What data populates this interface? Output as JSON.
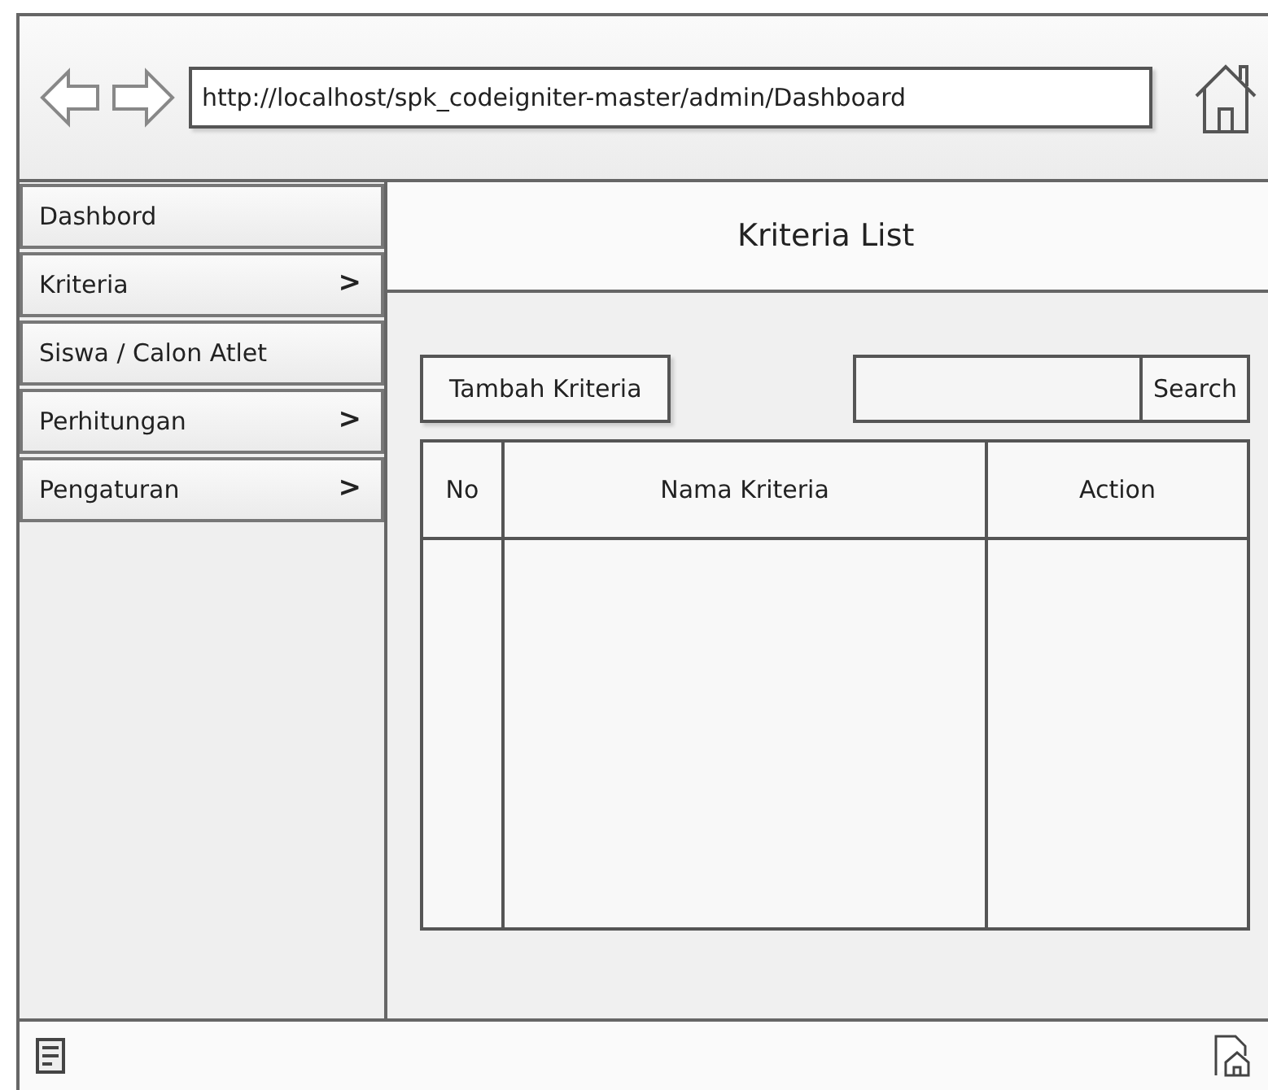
{
  "address_bar": {
    "url": "http://localhost/spk_codeigniter-master/admin/Dashboard"
  },
  "sidebar": {
    "items": [
      {
        "label": "Dashbord"
      },
      {
        "label": "Kriteria",
        "arrow": ">"
      },
      {
        "label": "Siswa / Calon Atlet"
      },
      {
        "label": "Perhitungan",
        "arrow": ">"
      },
      {
        "label": "Pengaturan",
        "arrow": ">"
      }
    ]
  },
  "page": {
    "title": "Kriteria List",
    "add_button": "Tambah Kriteria",
    "search_button": "Search"
  },
  "table": {
    "columns": [
      "No",
      "Nama Kriteria",
      "Action"
    ]
  }
}
